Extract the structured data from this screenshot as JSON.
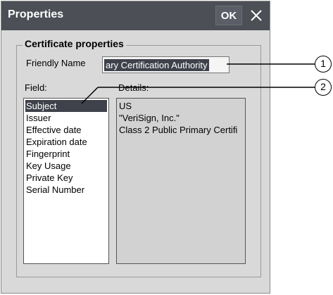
{
  "window": {
    "title": "Properties",
    "ok_label": "OK"
  },
  "group": {
    "title": "Certificate properties"
  },
  "friendly_name": {
    "label": "Friendly Name",
    "value": "ary Certification Authority"
  },
  "field": {
    "label": "Field:",
    "items": [
      "Subject",
      "Issuer",
      "Effective date",
      "Expiration date",
      "Fingerprint",
      "Key Usage",
      "Private Key",
      "Serial Number"
    ],
    "selected": "Subject"
  },
  "details": {
    "label": "Details:",
    "lines": [
      "US",
      "\"VeriSign, Inc.\"",
      "Class 2 Public Primary Certifi"
    ]
  },
  "callouts": [
    "1",
    "2"
  ],
  "icons": {
    "close": "close-icon"
  },
  "colors": {
    "titlebar": "#4c4f56",
    "selection": "#3f424a",
    "dialog_bg": "#d9d9d9"
  }
}
